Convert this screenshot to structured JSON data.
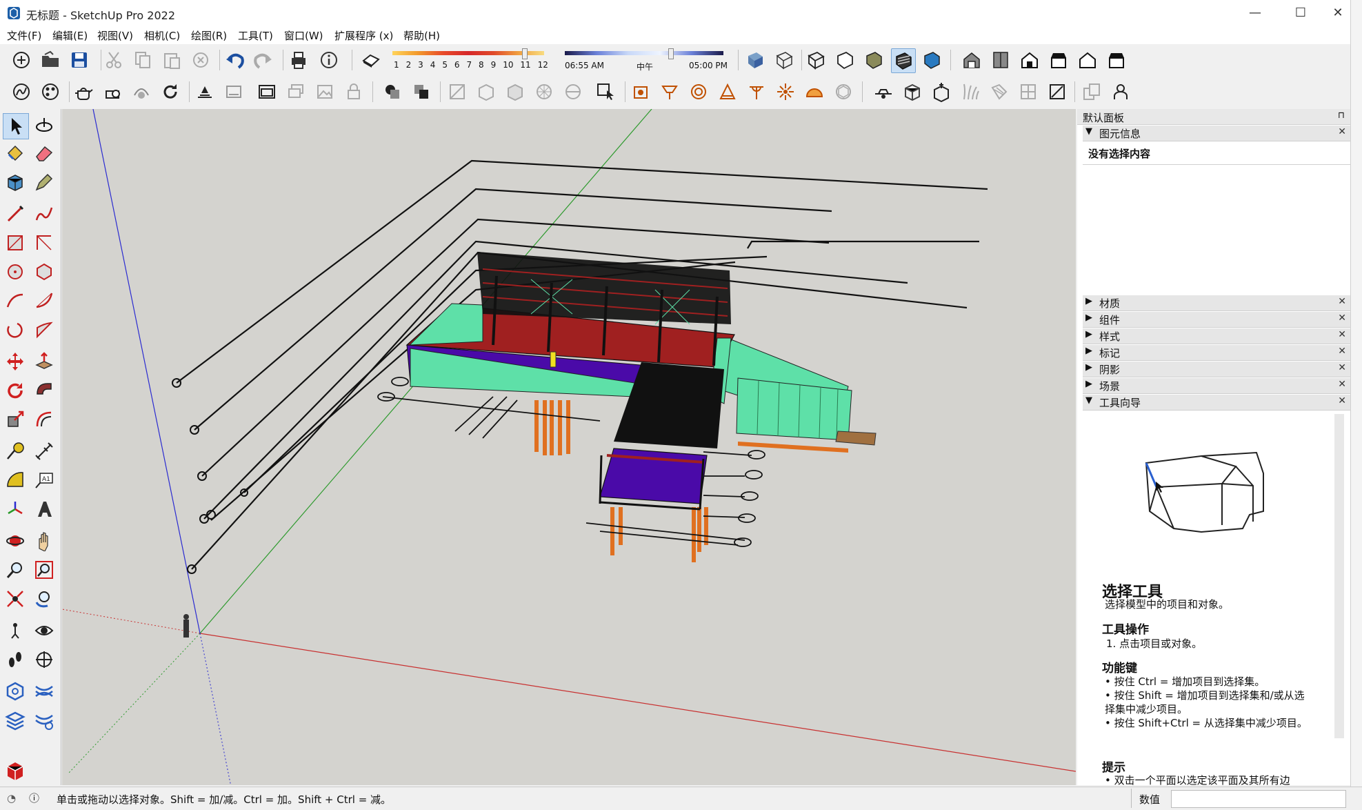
{
  "window": {
    "title": "无标题 - SketchUp Pro 2022",
    "minimize": "—",
    "maximize": "☐",
    "close": "✕"
  },
  "menu": [
    "文件(F)",
    "编辑(E)",
    "视图(V)",
    "相机(C)",
    "绘图(R)",
    "工具(T)",
    "窗口(W)",
    "扩展程序 (x)",
    "帮助(H)"
  ],
  "shadow": {
    "months": [
      "1",
      "2",
      "3",
      "4",
      "5",
      "6",
      "7",
      "8",
      "9",
      "10",
      "11",
      "12"
    ],
    "time_start": "06:55 AM",
    "time_mid": "中午",
    "time_end": "05:00 PM"
  },
  "panel": {
    "title": "默认面板",
    "pin": "⊓",
    "entity_info": {
      "label": "图元信息",
      "content": "没有选择内容"
    },
    "sections": [
      "材质",
      "组件",
      "样式",
      "标记",
      "阴影",
      "场景"
    ],
    "instructor": {
      "label": "工具向导",
      "tool_title": "选择工具",
      "tool_desc": "选择模型中的项目和对象。",
      "ops_title": "工具操作",
      "ops": [
        "1. 点击项目或对象。"
      ],
      "keys_title": "功能键",
      "keys": [
        "按住 Ctrl = 增加项目到选择集。",
        "按住 Shift = 增加项目到选择集和/或从选择集中减少项目。",
        "按住 Shift+Ctrl = 从选择集中减少项目。"
      ],
      "tips_title": "提示",
      "tips": [
        "双击一个平面以选定该平面及其所有边"
      ]
    }
  },
  "status": {
    "message": "单击或拖动以选择对象。Shift = 加/减。Ctrl = 加。Shift + Ctrl = 减。",
    "measure_label": "数值",
    "measure_value": ""
  },
  "colors": {
    "viewport_bg": "#d4d3cf",
    "axis_red": "#c83030",
    "axis_green": "#2e9a2e",
    "axis_blue": "#2a2ad0",
    "deck_purple": "#4a0aa8",
    "cladding_green": "#5ee0a8",
    "timber_red": "#a02020",
    "pile_orange": "#e07020"
  }
}
